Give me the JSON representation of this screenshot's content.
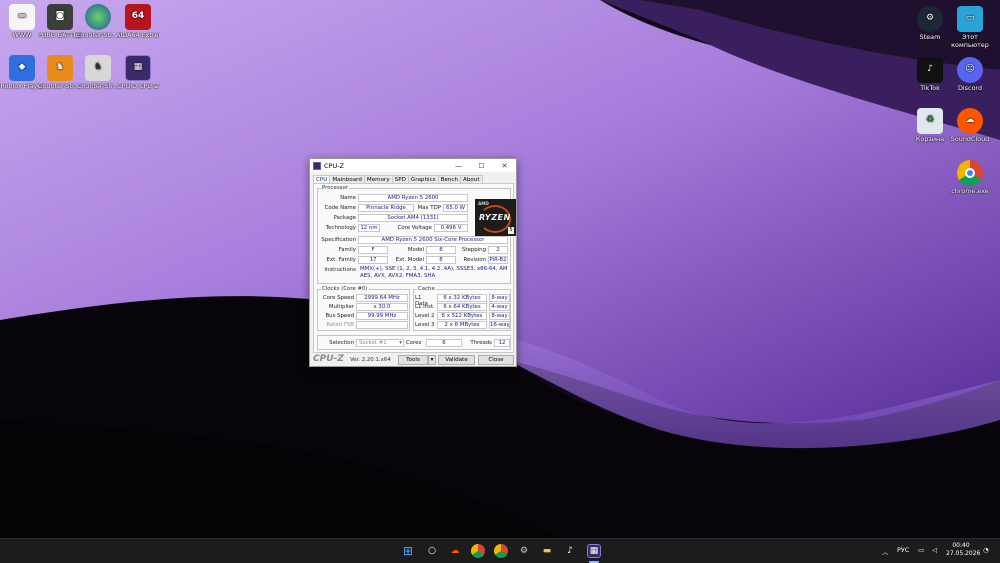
{
  "desktop": {
    "icons_left": [
      {
        "label": "WWW",
        "glyph": "folder-icon",
        "color": "#f5f5f5"
      },
      {
        "label": "PUBG BATTLEGR...",
        "glyph": "pubg-icon",
        "color": "#3b3f3a"
      },
      {
        "label": "Counter-Str... Offensive",
        "glyph": "globe-icon",
        "color": "#2a8a3a"
      },
      {
        "label": "AIDA64 Extreme",
        "glyph": "64",
        "color": "#b8141e"
      },
      {
        "label": "Roblox Player",
        "glyph": "roblox-icon",
        "color": "#2f6fe0"
      },
      {
        "label": "Counter-Str... 2",
        "glyph": "cs2-icon",
        "color": "#e88b1a"
      },
      {
        "label": "Counter-Str...",
        "glyph": "cs-icon",
        "color": "#5a5f66"
      },
      {
        "label": "CPUID CPU-Z",
        "glyph": "cpuz-icon",
        "color": "#3a2a6a"
      }
    ],
    "icons_right": [
      {
        "label": "Steam",
        "glyph": "steam-icon",
        "color": "#1b2838"
      },
      {
        "label": "Этот компьютер",
        "glyph": "monitor-icon",
        "color": "#2aa3d8"
      },
      {
        "label": "TikTok",
        "glyph": "tiktok-icon",
        "color": "#111"
      },
      {
        "label": "Discord",
        "glyph": "discord-icon",
        "color": "#5865f2"
      },
      {
        "label": "Корзина",
        "glyph": "recycle-bin-icon",
        "color": "#dfe8ee"
      },
      {
        "label": "SoundCloud",
        "glyph": "soundcloud-icon",
        "color": "#ff5500"
      },
      {
        "label": "chrome.exe",
        "glyph": "chrome-icon",
        "color": "#db4437"
      }
    ]
  },
  "cpuz": {
    "title": "CPU-Z",
    "tabs": [
      "CPU",
      "Mainboard",
      "Memory",
      "SPD",
      "Graphics",
      "Bench",
      "About"
    ],
    "processor": {
      "group": "Processor",
      "name_label": "Name",
      "name": "AMD Ryzen 5 2600",
      "codename_label": "Code Name",
      "codename": "Pinnacle Ridge",
      "maxtdp_label": "Max TDP",
      "maxtdp": "65.0 W",
      "package_label": "Package",
      "package": "Socket AM4 (1331)",
      "technology_label": "Technology",
      "technology": "12 nm",
      "corevoltage_label": "Core Voltage",
      "corevoltage": "0.496 V",
      "spec_label": "Specification",
      "spec": "AMD Ryzen 5 2600 Six-Core Processor",
      "family_label": "Family",
      "family": "F",
      "model_label": "Model",
      "model": "8",
      "stepping_label": "Stepping",
      "stepping": "2",
      "extfamily_label": "Ext. Family",
      "extfamily": "17",
      "extmodel_label": "Ext. Model",
      "extmodel": "8",
      "revision_label": "Revision",
      "revision": "PiR-B2",
      "instructions_label": "Instructions",
      "instructions1": "MMX(+), SSE (1, 2, 3, 4.1, 4.2, 4A), SSSE3, x86-64, AMD-V,",
      "instructions2": "AES, AVX, AVX2, FMA3, SHA",
      "badge_brand": "AMD",
      "badge_name": "RYZEN",
      "badge_num": "5"
    },
    "clocks": {
      "group": "Clocks (Core #0)",
      "corespeed_label": "Core Speed",
      "corespeed": "2999.64 MHz",
      "multiplier_label": "Multiplier",
      "multiplier": "x 30.0",
      "busspeed_label": "Bus Speed",
      "busspeed": "99.99 MHz",
      "ratedfsb_label": "Rated FSB",
      "ratedfsb": ""
    },
    "cache": {
      "group": "Cache",
      "l1d_label": "L1 Data",
      "l1d": "6 x 32 KBytes",
      "l1d_way": "8-way",
      "l1i_label": "L1 Inst.",
      "l1i": "6 x 64 KBytes",
      "l1i_way": "4-way",
      "l2_label": "Level 2",
      "l2": "6 x 512 KBytes",
      "l2_way": "8-way",
      "l3_label": "Level 3",
      "l3": "2 x 8 MBytes",
      "l3_way": "16-way"
    },
    "selection_label": "Selection",
    "selection": "Socket #1",
    "cores_label": "Cores",
    "cores": "6",
    "threads_label": "Threads",
    "threads": "12",
    "footer": {
      "logo": "CPU-Z",
      "version": "Ver. 2.20.1.x64",
      "tools": "Tools",
      "validate": "Validate",
      "close": "Close"
    }
  },
  "taskbar": {
    "lang": "РУС",
    "time": "00:40",
    "date": "27.05.2026"
  }
}
